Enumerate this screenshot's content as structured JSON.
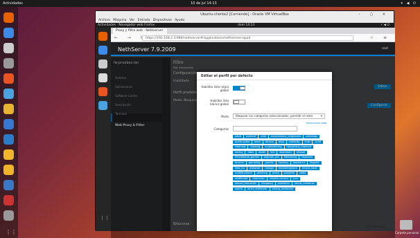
{
  "ubuntu": {
    "activities": "Actividades",
    "clock": "10 de jul 14:13",
    "trash_label": "Carpeta personal"
  },
  "vbox": {
    "title": "Ubuntu-cliente2 [Corriendo] - Oracle VM VirtualBox",
    "menu": "Archivo  Máquina  Ver  Entrada  Dispositivos  Ayuda",
    "guest_activities": "Actividades",
    "guest_app": "Navegador web Firefox",
    "guest_clock": "dom 14:13",
    "status_right": "Ctrl Derecho"
  },
  "firefox": {
    "tab_title": "Proxy y filtro web - Nethserver",
    "url": "https://192.168.2.3:980/nethserver#/applications/nethserver-squid"
  },
  "nethserver": {
    "brand": "NethServer 7.9.2009",
    "user": "root",
    "hostname": "fw.pruebas.lan",
    "nav": [
      "Sistema",
      "Aplicaciones",
      "Software Center",
      "Suscripción",
      "Terminal",
      "Web Proxy & Filter"
    ],
    "main_filter": "Filtro",
    "main_url": "Más información",
    "main_config": "Configuración",
    "main_enabled": "Habilitado",
    "main_profile": "Perfil predeterminado",
    "main_mode": "Modo",
    "main_mode_val": "Bloquear",
    "main_bottom": "Bitácoras",
    "btn_edit": "Editar",
    "btn_config": "Configurar"
  },
  "modal": {
    "title": "Editar el perfil por defecto",
    "labels": {
      "black": "Habilitar lista negra global",
      "white": "Habilitar lista blanca global",
      "mode": "Modo",
      "categories": "Categorías"
    },
    "mode_value": "Bloquear las categorías seleccionadas, permitir el resto",
    "select_all": "Seleccionar todo",
    "black_enabled": true,
    "white_enabled": false,
    "categories": [
      "adult",
      "agressif",
      "arjel",
      "associations_religieuses",
      "astrology",
      "audio-video",
      "bank",
      "bitcoin",
      "blog",
      "celebrity",
      "chat",
      "child",
      "cleaning",
      "cooking",
      "cryptojacking",
      "dangerous_material",
      "dating",
      "ddos",
      "dialer",
      "dnt",
      "download",
      "drogue",
      "educational_games",
      "examen_pix",
      "filehosting",
      "financial",
      "forums",
      "gambling",
      "games",
      "hacking",
      "jobsearch",
      "lingerie",
      "liste_bu",
      "malware",
      "manga",
      "marketingware",
      "mixed_adult",
      "mobile-phone",
      "phishing",
      "press",
      "publicite",
      "radio",
      "reaffected",
      "redirector",
      "remote-control",
      "sect",
      "sexual_education",
      "shopping",
      "shortener",
      "social_networks",
      "sports",
      "strict_redirector",
      "strong_redirector"
    ]
  }
}
